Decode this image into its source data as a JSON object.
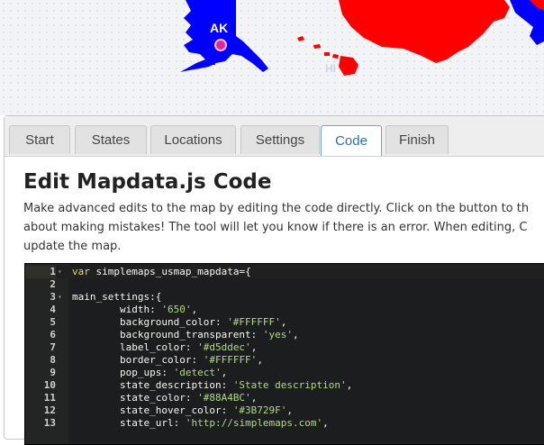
{
  "map": {
    "labels": {
      "ak": "AK",
      "hi": "HI"
    },
    "colors": {
      "blue_states": "#0000ff",
      "red_states": "#ff0000",
      "marker": "#e0288f"
    }
  },
  "tabs": [
    {
      "label": "Start"
    },
    {
      "label": "States"
    },
    {
      "label": "Locations"
    },
    {
      "label": "Settings"
    },
    {
      "label": "Code",
      "active": true
    },
    {
      "label": "Finish"
    }
  ],
  "page": {
    "title": "Edit Mapdata.js Code",
    "intro_lines": [
      "Make advanced edits to the map by editing the code directly. Click on the button to th",
      "about making mistakes! The tool will let you know if there is an error. When editing, C",
      "update the map."
    ]
  },
  "editor": {
    "lines": [
      {
        "n": "1",
        "fold": "▾",
        "parts": [
          [
            "kw",
            "var "
          ],
          [
            "key",
            "simplemaps_usmap_mapdata={"
          ]
        ]
      },
      {
        "n": "2",
        "fold": "",
        "parts": []
      },
      {
        "n": "3",
        "fold": "▾",
        "parts": [
          [
            "key",
            "main_settings:{"
          ]
        ]
      },
      {
        "n": "4",
        "fold": "",
        "parts": [
          [
            "key",
            "        width: "
          ],
          [
            "str",
            "'650'"
          ],
          [
            "key",
            ","
          ]
        ]
      },
      {
        "n": "5",
        "fold": "",
        "parts": [
          [
            "key",
            "        background_color: "
          ],
          [
            "str",
            "'#FFFFFF'"
          ],
          [
            "key",
            ","
          ]
        ]
      },
      {
        "n": "6",
        "fold": "",
        "parts": [
          [
            "key",
            "        background_transparent: "
          ],
          [
            "str",
            "'yes'"
          ],
          [
            "key",
            ","
          ]
        ]
      },
      {
        "n": "7",
        "fold": "",
        "parts": [
          [
            "key",
            "        label_color: "
          ],
          [
            "str",
            "'#d5ddec'"
          ],
          [
            "key",
            ","
          ]
        ]
      },
      {
        "n": "8",
        "fold": "",
        "parts": [
          [
            "key",
            "        border_color: "
          ],
          [
            "str",
            "'#FFFFFF'"
          ],
          [
            "key",
            ","
          ]
        ]
      },
      {
        "n": "9",
        "fold": "",
        "parts": [
          [
            "key",
            "        pop_ups: "
          ],
          [
            "str",
            "'detect'"
          ],
          [
            "key",
            ","
          ]
        ]
      },
      {
        "n": "10",
        "fold": "",
        "parts": [
          [
            "key",
            "        state_description: "
          ],
          [
            "str",
            "'State description'"
          ],
          [
            "key",
            ","
          ]
        ]
      },
      {
        "n": "11",
        "fold": "",
        "parts": [
          [
            "key",
            "        state_color: "
          ],
          [
            "str",
            "'#88A4BC'"
          ],
          [
            "key",
            ","
          ]
        ]
      },
      {
        "n": "12",
        "fold": "",
        "parts": [
          [
            "key",
            "        state_hover_color: "
          ],
          [
            "str",
            "'#3B729F'"
          ],
          [
            "key",
            ","
          ]
        ]
      },
      {
        "n": "13",
        "fold": "",
        "parts": [
          [
            "key",
            "        state_url: "
          ],
          [
            "str",
            "'http://simplemaps.com'"
          ],
          [
            "key",
            ","
          ]
        ]
      }
    ]
  }
}
